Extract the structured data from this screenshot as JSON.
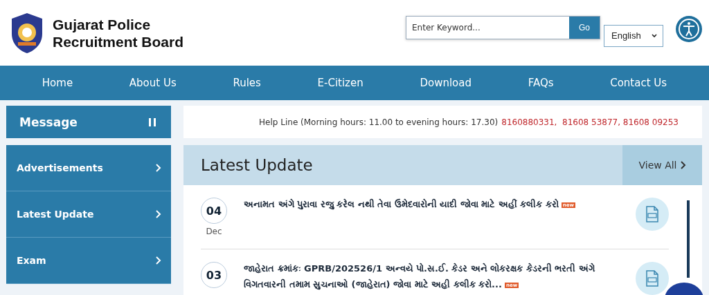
{
  "header": {
    "title_line1": "Gujarat Police",
    "title_line2": "Recruitment Board",
    "search": {
      "placeholder": "Enter Keyword...",
      "button": "Go"
    },
    "language": "English"
  },
  "nav": [
    "Home",
    "About Us",
    "Rules",
    "E-Citizen",
    "Download",
    "FAQs",
    "Contact Us"
  ],
  "sidebar": {
    "message_title": "Message",
    "paused": true,
    "items": [
      "Advertisements",
      "Latest Update",
      "Exam"
    ]
  },
  "helpline": {
    "text": "Help Line (Morning hours: 11.00 to evening hours: 17.30)",
    "numbers": "8160880331,  81608 53877, 81608 09253"
  },
  "latest": {
    "title": "Latest Update",
    "view_all": "View All",
    "items": [
      {
        "day": "04",
        "month": "Dec",
        "text": "અનામત અંગે પુરાવા રજુ કરેલ નથી તેવા ઉમેદવારોની યાદી જોવા માટે અહીં કલીક કરો",
        "badge": "new"
      },
      {
        "day": "03",
        "text": "જાહેરાત ક્રમાંકઃ GPRB/202526/1 અન્વયે પો.સ.ઈ. કેડર અને લોકરક્ષક કેડરની ભરતી અંગે વિગતવારની તમામ સુચનાઓ (જાહેરાત) જોવા માટે અહી કલીક કરો...",
        "badge": "new"
      }
    ]
  }
}
